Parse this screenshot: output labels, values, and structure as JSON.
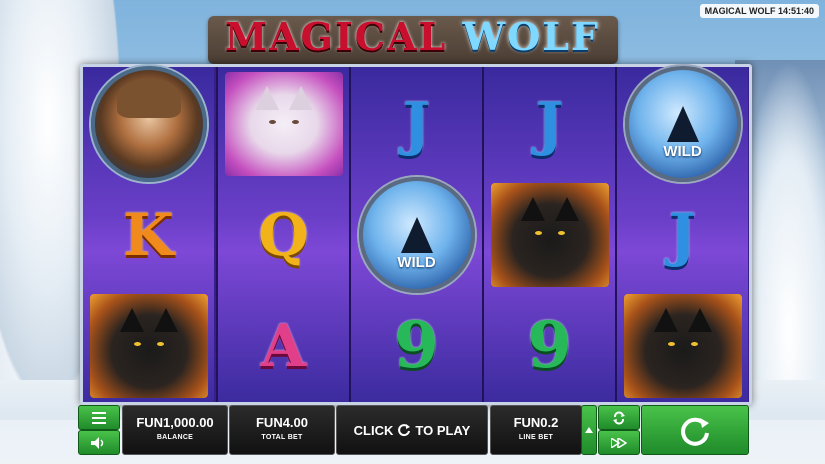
{
  "clock": {
    "text": "MAGICAL WOLF 14:51:40"
  },
  "logo": {
    "part1": "MAGICAL",
    "part2": "WOLF"
  },
  "reels": [
    [
      "huntress",
      "K",
      "black-wolf"
    ],
    [
      "white-wolf",
      "Q",
      "A"
    ],
    [
      "J",
      "wild",
      "9"
    ],
    [
      "J",
      "black-wolf",
      "9"
    ],
    [
      "wild",
      "J",
      "black-wolf"
    ]
  ],
  "wild_label": "WILD",
  "controls": {
    "menu_icon": "menu-icon",
    "sound_icon": "speaker-icon",
    "balance_value": "FUN1,000.00",
    "balance_label": "BALANCE",
    "total_bet_value": "FUN4.00",
    "total_bet_label": "TOTAL BET",
    "play_text_a": "CLICK",
    "play_text_b": "TO PLAY",
    "line_bet_value": "FUN0.2",
    "line_bet_label": "LINE BET",
    "autoplay_icon": "repeat-icon",
    "turbo_icon": "fast-forward-icon",
    "spin_icon": "spin-icon"
  },
  "colors": {
    "accent": "#2fa83a",
    "reel_bg": "#6a3fc8"
  }
}
